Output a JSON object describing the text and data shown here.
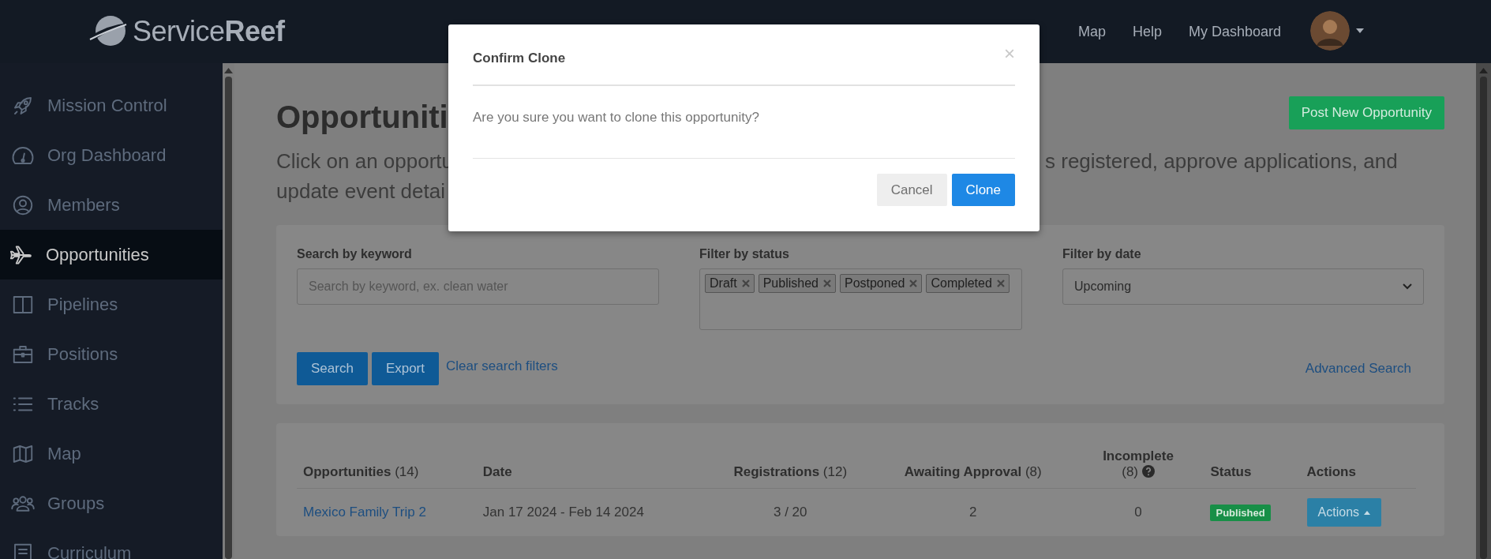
{
  "header": {
    "logo": "Service**Reef**",
    "nav": [
      {
        "label": "Map"
      },
      {
        "label": "Help"
      },
      {
        "label": "My Dashboard"
      }
    ]
  },
  "sidebar": {
    "items": [
      {
        "label": "Mission Control",
        "selected": false
      },
      {
        "label": "Org Dashboard",
        "selected": false
      },
      {
        "label": "Members",
        "selected": false
      },
      {
        "label": "Opportunities",
        "selected": true
      },
      {
        "label": "Pipelines",
        "selected": false
      },
      {
        "label": "Positions",
        "selected": false
      },
      {
        "label": "Tracks",
        "selected": false
      },
      {
        "label": "Map",
        "selected": false
      },
      {
        "label": "Groups",
        "selected": false
      },
      {
        "label": "Curriculum",
        "selected": false
      }
    ]
  },
  "page": {
    "title": "Opportuniti",
    "post_button": "Post New Opportunity",
    "description_lines": [
      {
        "left": "Click on an opportu",
        "right": "s registered, approve applications, and"
      },
      {
        "left": "update event detai"
      }
    ]
  },
  "filters": {
    "keyword": {
      "label": "Search by keyword",
      "placeholder": "Search by keyword, ex. clean water"
    },
    "status": {
      "label": "Filter by status",
      "tags": [
        "Draft",
        "Published",
        "Postponed",
        "Completed"
      ]
    },
    "date": {
      "label": "Filter by date",
      "value": "Upcoming"
    },
    "buttons": [
      "Search",
      "Export"
    ],
    "clear_link": "Clear search filters",
    "advanced_link": "Advanced Search"
  },
  "table": {
    "columns": [
      {
        "label": "**Opportunities** (14)"
      },
      {
        "label": "**Date**"
      },
      {
        "label": "**Registrations** (12)"
      },
      {
        "label": "**Awaiting Approval** (8)"
      },
      {
        "label": "**Incomplete** (8)"
      },
      {
        "label": "**Status**"
      },
      {
        "label": "**Actions**"
      }
    ],
    "rows": [
      {
        "cells": [
          "Mexico Family Trip 2",
          "Jan 17 2024 - Feb 14 2024",
          "3 / 20",
          "2",
          "0"
        ],
        "status": "Published",
        "action": "Actions"
      }
    ]
  },
  "modal": {
    "title": "Confirm Clone",
    "close": "×",
    "message": "Are you sure you want to clone this opportunity?",
    "buttons": [
      {
        "label": "Cancel",
        "kind": "secondary"
      },
      {
        "label": "Clone",
        "kind": "primary"
      }
    ]
  }
}
